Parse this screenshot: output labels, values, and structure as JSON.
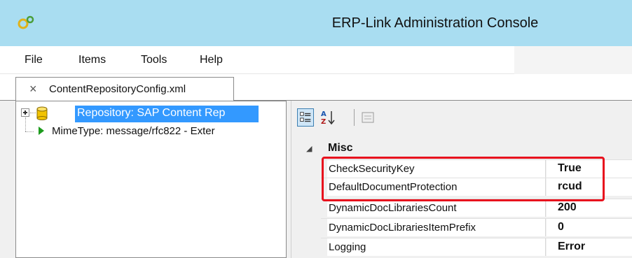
{
  "window": {
    "title": "ERP-Link Administration Console",
    "icon": "app-gears-icon"
  },
  "menu": {
    "items": [
      "File",
      "Items",
      "Tools",
      "Help"
    ]
  },
  "document_tab": {
    "close_glyph": "×",
    "label": "ContentRepositoryConfig.xml"
  },
  "tree": {
    "items": [
      {
        "label": "Repository: SAP Content Rep",
        "icon": "database-icon",
        "selected": true,
        "expander": "plus"
      },
      {
        "label": "MimeType: message/rfc822 - Exter",
        "icon": "play-arrow-icon",
        "selected": false
      }
    ]
  },
  "property_grid": {
    "toolbar": [
      "categorized-icon",
      "alphabetical-sort-icon",
      "property-pages-icon"
    ],
    "category": {
      "label": "Misc",
      "toggle": "◢"
    },
    "rows": [
      {
        "name": "CheckSecurityKey",
        "value": "True"
      },
      {
        "name": "DefaultDocumentProtection",
        "value": "rcud"
      },
      {
        "name": "DynamicDocLibrariesCount",
        "value": "200"
      },
      {
        "name": "DynamicDocLibrariesItemPrefix",
        "value": "0"
      },
      {
        "name": "Logging",
        "value": "Error"
      }
    ],
    "highlight_color": "#e8101d"
  },
  "colors": {
    "titlebar": "#a9ddf1",
    "selection": "#3399ff"
  }
}
